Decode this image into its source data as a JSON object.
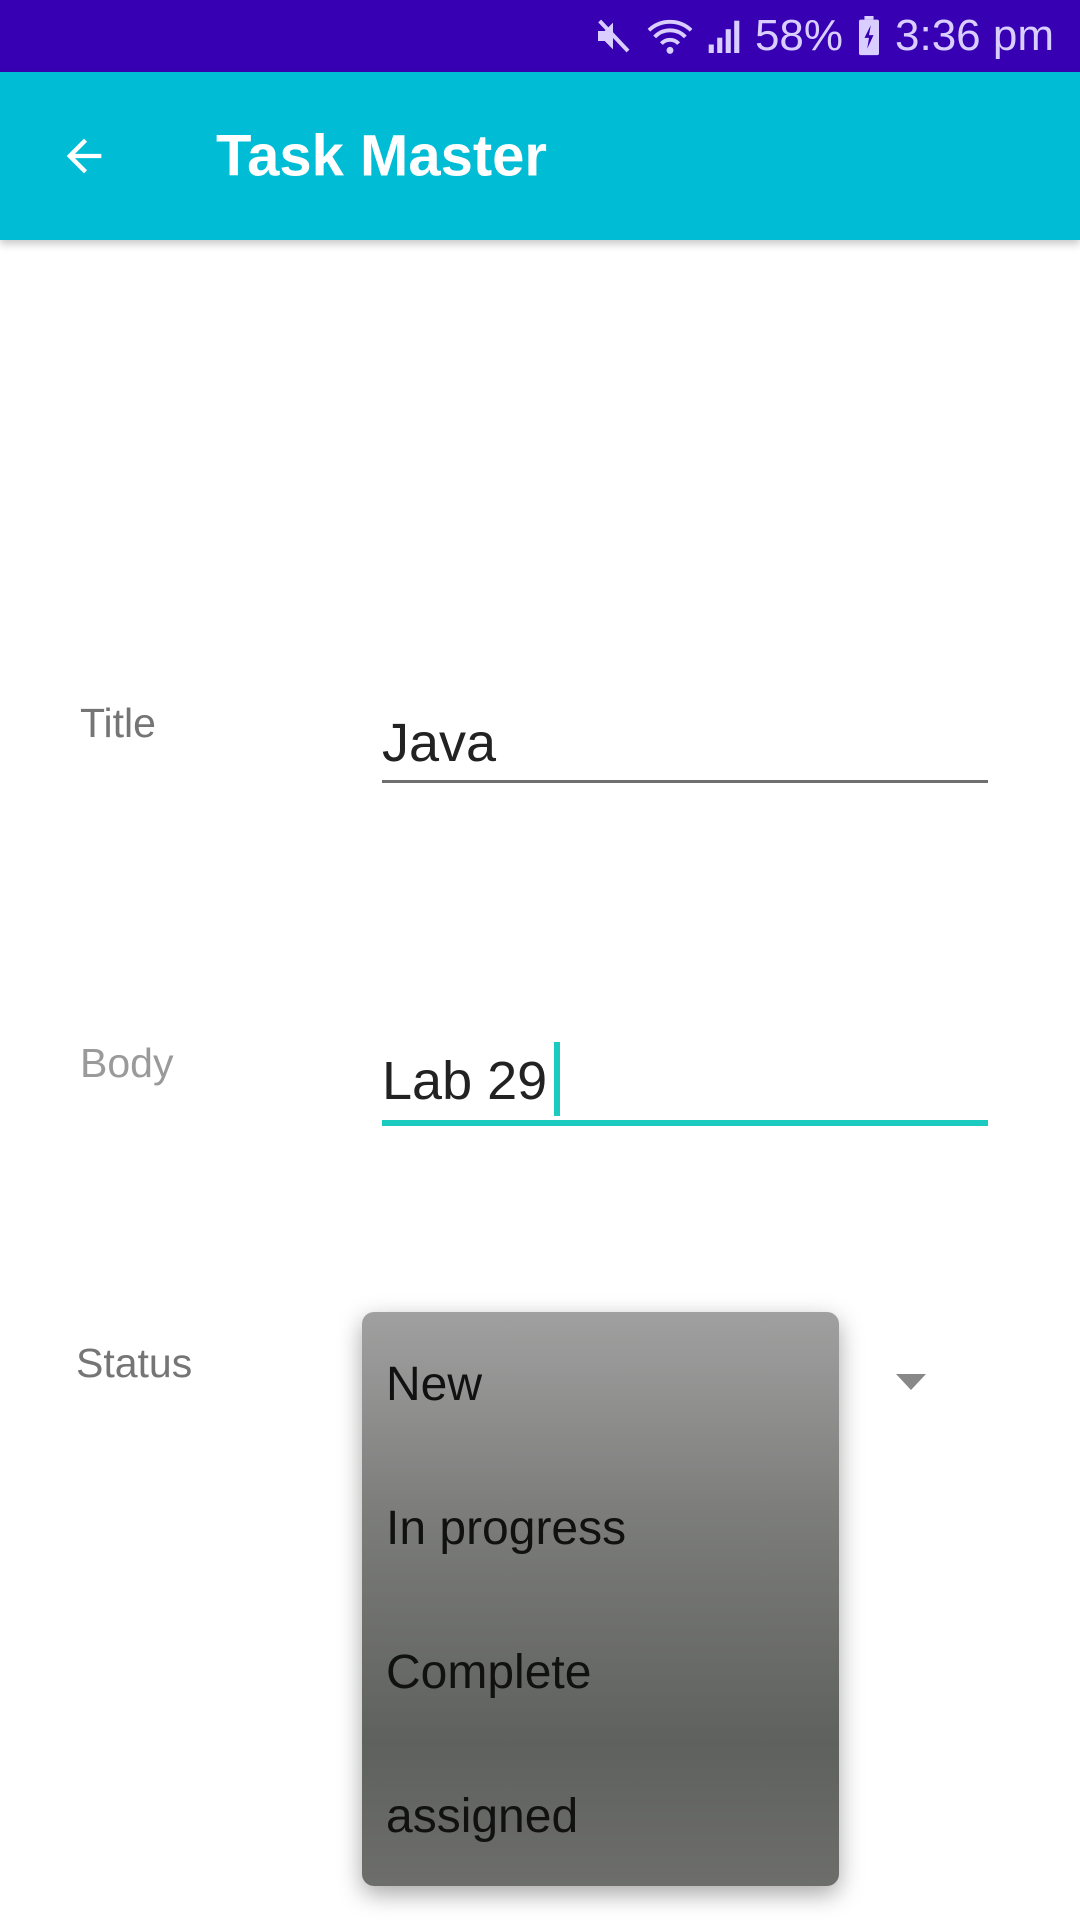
{
  "status_bar": {
    "battery": "58%",
    "time": "3:36 pm",
    "icons": [
      "mute-icon",
      "wifi-icon",
      "signal-icon",
      "battery-icon"
    ]
  },
  "app_bar": {
    "title": "Task Master",
    "back_icon": "arrow-back-icon"
  },
  "form": {
    "title_label": "Title",
    "title_value": "Java",
    "body_label": "Body",
    "body_value": "Lab 29",
    "status_label": "Status"
  },
  "status_dropdown": {
    "options": [
      "New",
      "In progress",
      "Complete",
      "assigned"
    ]
  },
  "colors": {
    "status_bar": "#3700b3",
    "app_bar": "#00bcd4",
    "accent": "#1ccbc0"
  }
}
